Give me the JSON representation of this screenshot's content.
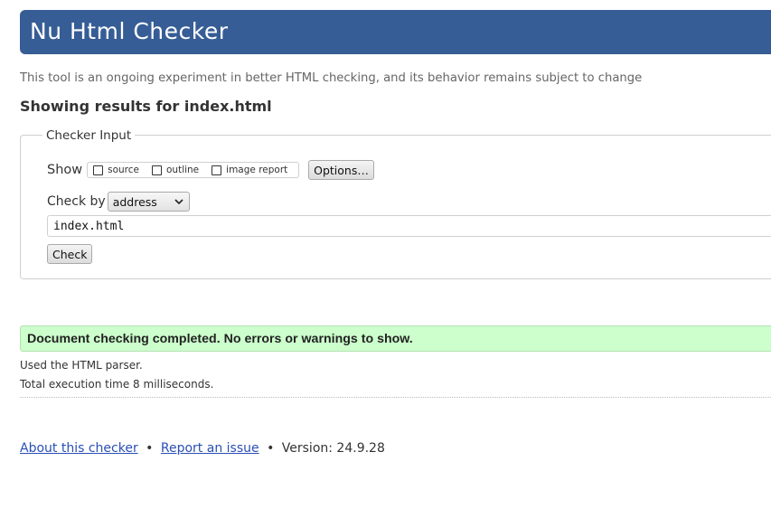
{
  "header": {
    "title": "Nu Html Checker"
  },
  "tagline": "This tool is an ongoing experiment in better HTML checking, and its behavior remains subject to change",
  "results_heading": "Showing results for index.html",
  "checker_input": {
    "legend": "Checker Input",
    "show_label": "Show",
    "show_options": [
      {
        "label": "source",
        "checked": false
      },
      {
        "label": "outline",
        "checked": false
      },
      {
        "label": "image report",
        "checked": false
      }
    ],
    "options_button": "Options…",
    "check_by_label": "Check by",
    "check_by_selected": "address",
    "url_value": "index.html",
    "check_button": "Check"
  },
  "result": {
    "success_message": "Document checking completed. No errors or warnings to show.",
    "parser_info": "Used the HTML parser.",
    "time_info": "Total execution time 8 milliseconds."
  },
  "footer": {
    "about_link": "About this checker",
    "separator": "•",
    "report_link": "Report an issue",
    "version": "Version: 24.9.28"
  },
  "colors": {
    "header_bg": "#365d95",
    "success_bg": "#ccffcc",
    "link": "#2a4fb5"
  }
}
